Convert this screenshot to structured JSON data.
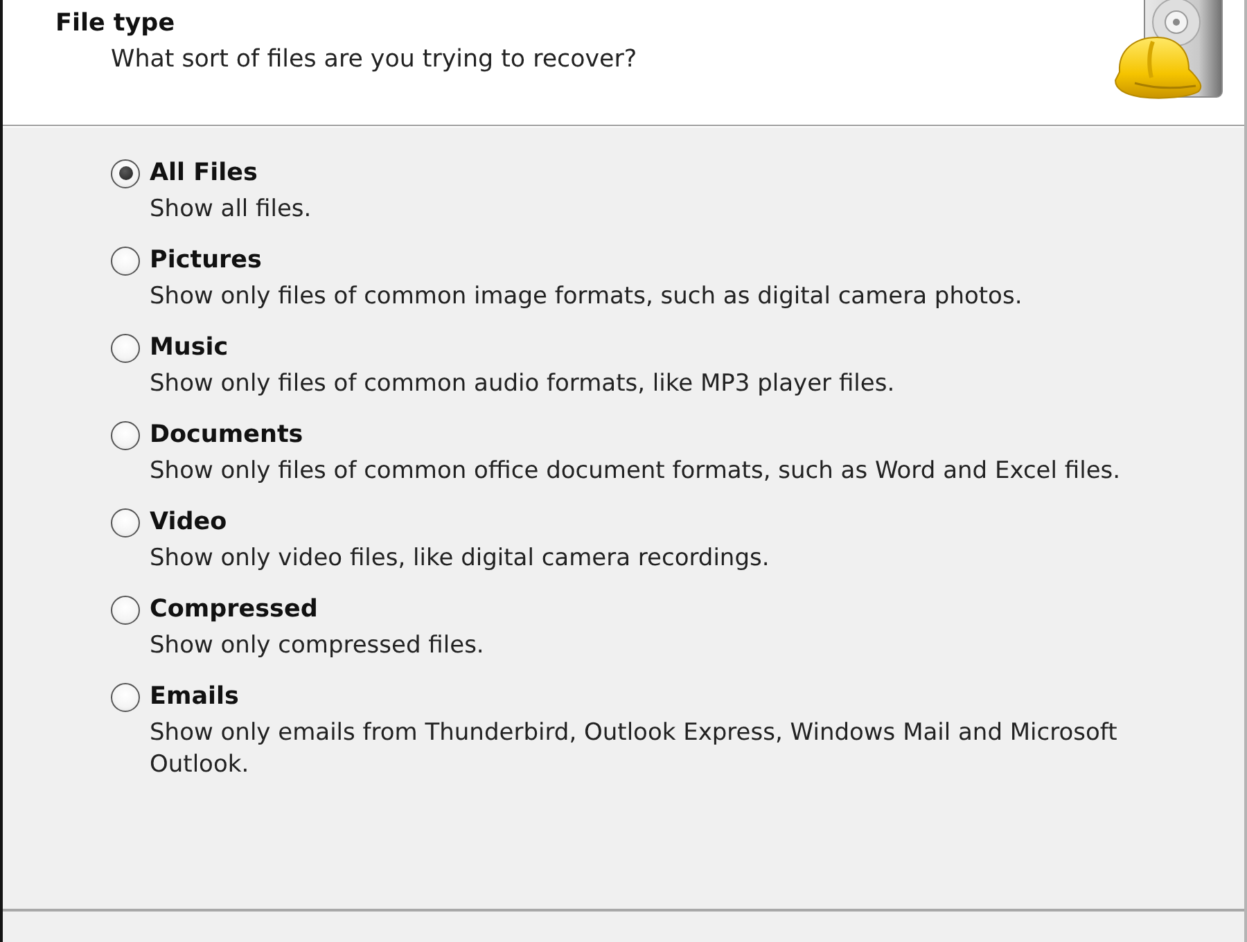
{
  "header": {
    "title": "File type",
    "subtitle": "What sort of files are you trying to recover?"
  },
  "options": [
    {
      "label": "All Files",
      "description": "Show all files.",
      "selected": true
    },
    {
      "label": "Pictures",
      "description": "Show only files of common image formats, such as digital camera photos.",
      "selected": false
    },
    {
      "label": "Music",
      "description": "Show only files of common audio formats, like MP3 player files.",
      "selected": false
    },
    {
      "label": "Documents",
      "description": "Show only files of common office document formats, such as Word and Excel files.",
      "selected": false
    },
    {
      "label": "Video",
      "description": "Show only video files, like digital camera recordings.",
      "selected": false
    },
    {
      "label": "Compressed",
      "description": "Show only compressed files.",
      "selected": false
    },
    {
      "label": "Emails",
      "description": "Show only emails from Thunderbird, Outlook Express, Windows Mail and Microsoft Outlook.",
      "selected": false
    }
  ]
}
